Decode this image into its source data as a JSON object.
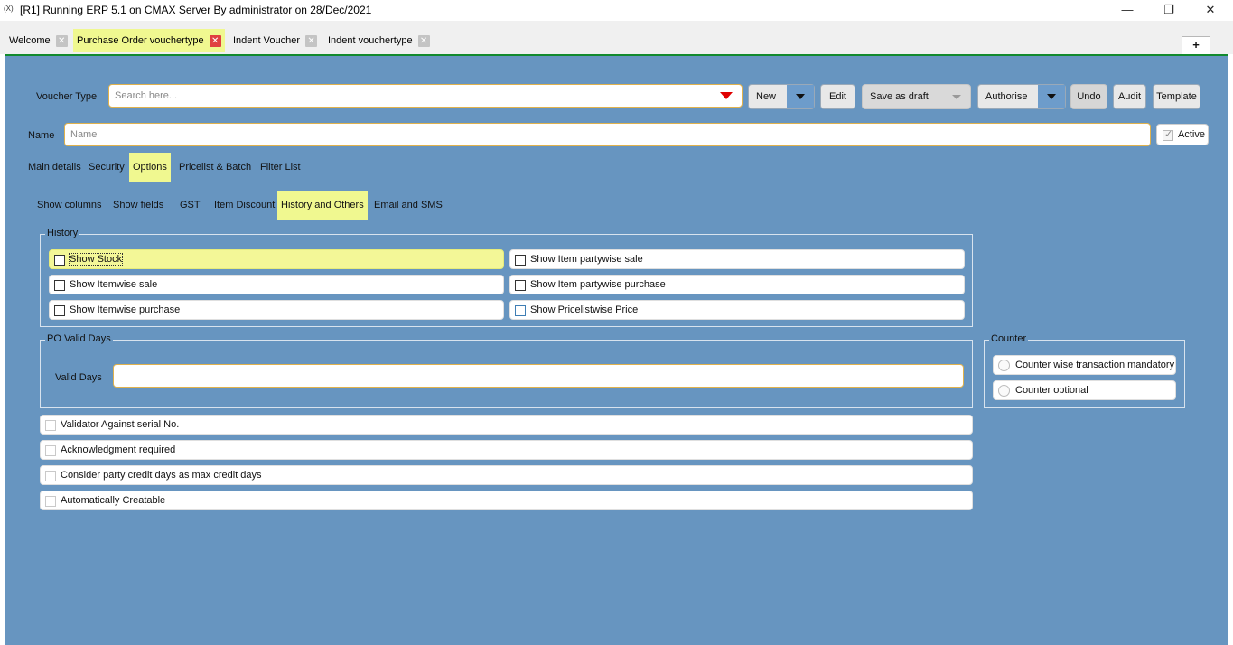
{
  "window": {
    "app_icon": "(X)",
    "title": "[R1] Running ERP 5.1 on CMAX Server By administrator on 28/Dec/2021",
    "minimize": "—",
    "restore": "❐",
    "close": "✕"
  },
  "tabs": [
    {
      "label": "Welcome"
    },
    {
      "label": "Purchase Order vouchertype"
    },
    {
      "label": "Indent Voucher"
    },
    {
      "label": "Indent vouchertype"
    }
  ],
  "tab_close_glyph": "✕",
  "plus_label": "+",
  "toolbar": {
    "voucher_type_label": "Voucher Type",
    "search_placeholder": "Search here...",
    "new_label": "New",
    "edit_label": "Edit",
    "save_draft_label": "Save as draft",
    "authorise_label": "Authorise",
    "undo_label": "Undo",
    "audit_label": "Audit",
    "template_label": "Template"
  },
  "name_row": {
    "label": "Name",
    "placeholder": "Name",
    "active_label": "Active",
    "active_checked": true
  },
  "main_tabs": [
    "Main details",
    "Security",
    "Options",
    "Pricelist & Batch",
    "Filter List"
  ],
  "main_tab_active": "Options",
  "sub_tabs": [
    "Show columns",
    "Show fields",
    "GST",
    "Item Discount",
    "History and Others",
    "Email and SMS"
  ],
  "sub_tab_active": "History and Others",
  "history": {
    "title": "History",
    "left": [
      "Show Stock",
      "Show Itemwise sale",
      "Show Itemwise purchase"
    ],
    "right": [
      "Show Item partywise sale",
      "Show Item partywise purchase",
      "Show Pricelistwise Price"
    ]
  },
  "po_valid": {
    "title": "PO Valid Days",
    "label": "Valid Days",
    "value": ""
  },
  "options": [
    "Validator Against serial No.",
    "Acknowledgment required",
    "Consider party credit days as max credit days",
    "Automatically Creatable"
  ],
  "counter": {
    "title": "Counter",
    "items": [
      "Counter wise transaction mandatory",
      "Counter optional"
    ]
  },
  "colors": {
    "panel_bg": "#6795c0",
    "highlight": "#f0f890",
    "accent_line": "#128a2e",
    "input_border": "#e0b24d",
    "dropdown_arrow": "#e00000"
  }
}
